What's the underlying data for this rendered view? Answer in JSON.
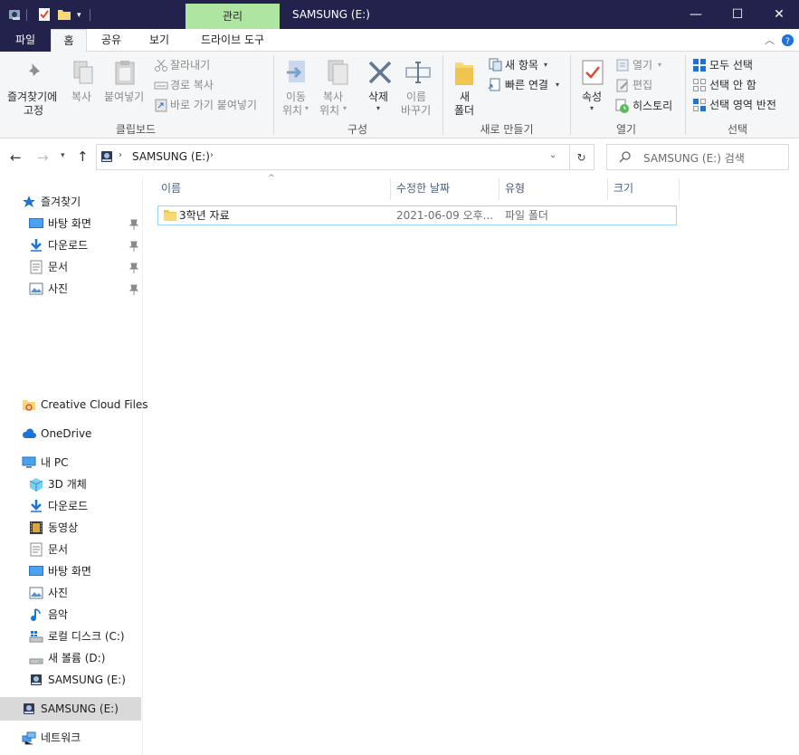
{
  "titlebar": {
    "title": "SAMSUNG (E:)",
    "context_tab": "관리",
    "minimize": "—",
    "maximize": "☐",
    "close": "✕"
  },
  "tabs": {
    "file": "파일",
    "home": "홈",
    "share": "공유",
    "view": "보기",
    "drive_tools": "드라이브 도구"
  },
  "ribbon": {
    "clipboard": {
      "group": "클립보드",
      "pin_line1": "즐겨찾기에",
      "pin_line2": "고정",
      "copy": "복사",
      "paste": "붙여넣기",
      "cut": "잘라내기",
      "copy_path": "경로 복사",
      "paste_shortcut": "바로 가기 붙여넣기"
    },
    "organize": {
      "group": "구성",
      "move_line1": "이동",
      "move_line2": "위치",
      "copy_line1": "복사",
      "copy_line2": "위치",
      "delete": "삭제",
      "rename_line1": "이름",
      "rename_line2": "바꾸기"
    },
    "new": {
      "group": "새로 만들기",
      "folder_line1": "새",
      "folder_line2": "폴더",
      "new_item": "새 항목",
      "easy_access": "빠른 연결"
    },
    "open": {
      "group": "열기",
      "properties": "속성",
      "open": "열기",
      "edit": "편집",
      "history": "히스토리"
    },
    "select": {
      "group": "선택",
      "select_all": "모두 선택",
      "select_none": "선택 안 함",
      "invert": "선택 영역 반전"
    }
  },
  "address": {
    "crumb": "SAMSUNG (E:)",
    "search_placeholder": "SAMSUNG (E:) 검색"
  },
  "nav": {
    "quick_access": "즐겨찾기",
    "qa_items": [
      "바탕 화면",
      "다운로드",
      "문서",
      "사진"
    ],
    "creative_cloud": "Creative Cloud Files",
    "onedrive": "OneDrive",
    "this_pc": "내 PC",
    "pc_items": [
      "3D 개체",
      "다운로드",
      "동영상",
      "문서",
      "바탕 화면",
      "사진",
      "음악",
      "로컬 디스크 (C:)",
      "새 볼륨 (D:)",
      "SAMSUNG (E:)"
    ],
    "selected": "SAMSUNG (E:)",
    "network": "네트워크"
  },
  "columns": {
    "name": "이름",
    "modified": "수정한 날짜",
    "type": "유형",
    "size": "크기"
  },
  "files": [
    {
      "name": "3학년 자료",
      "modified": "2021-06-09 오후...",
      "type": "파일 폴더",
      "size": ""
    }
  ],
  "colors": {
    "titlebar": "#23224c",
    "context_tab": "#aee5a0",
    "ribbon_bg": "#f5f6f7",
    "selection_border": "#99d1ff",
    "nav_selected": "#d9d9d9",
    "folder": "#f8d775",
    "accent_blue": "#0078d7"
  }
}
